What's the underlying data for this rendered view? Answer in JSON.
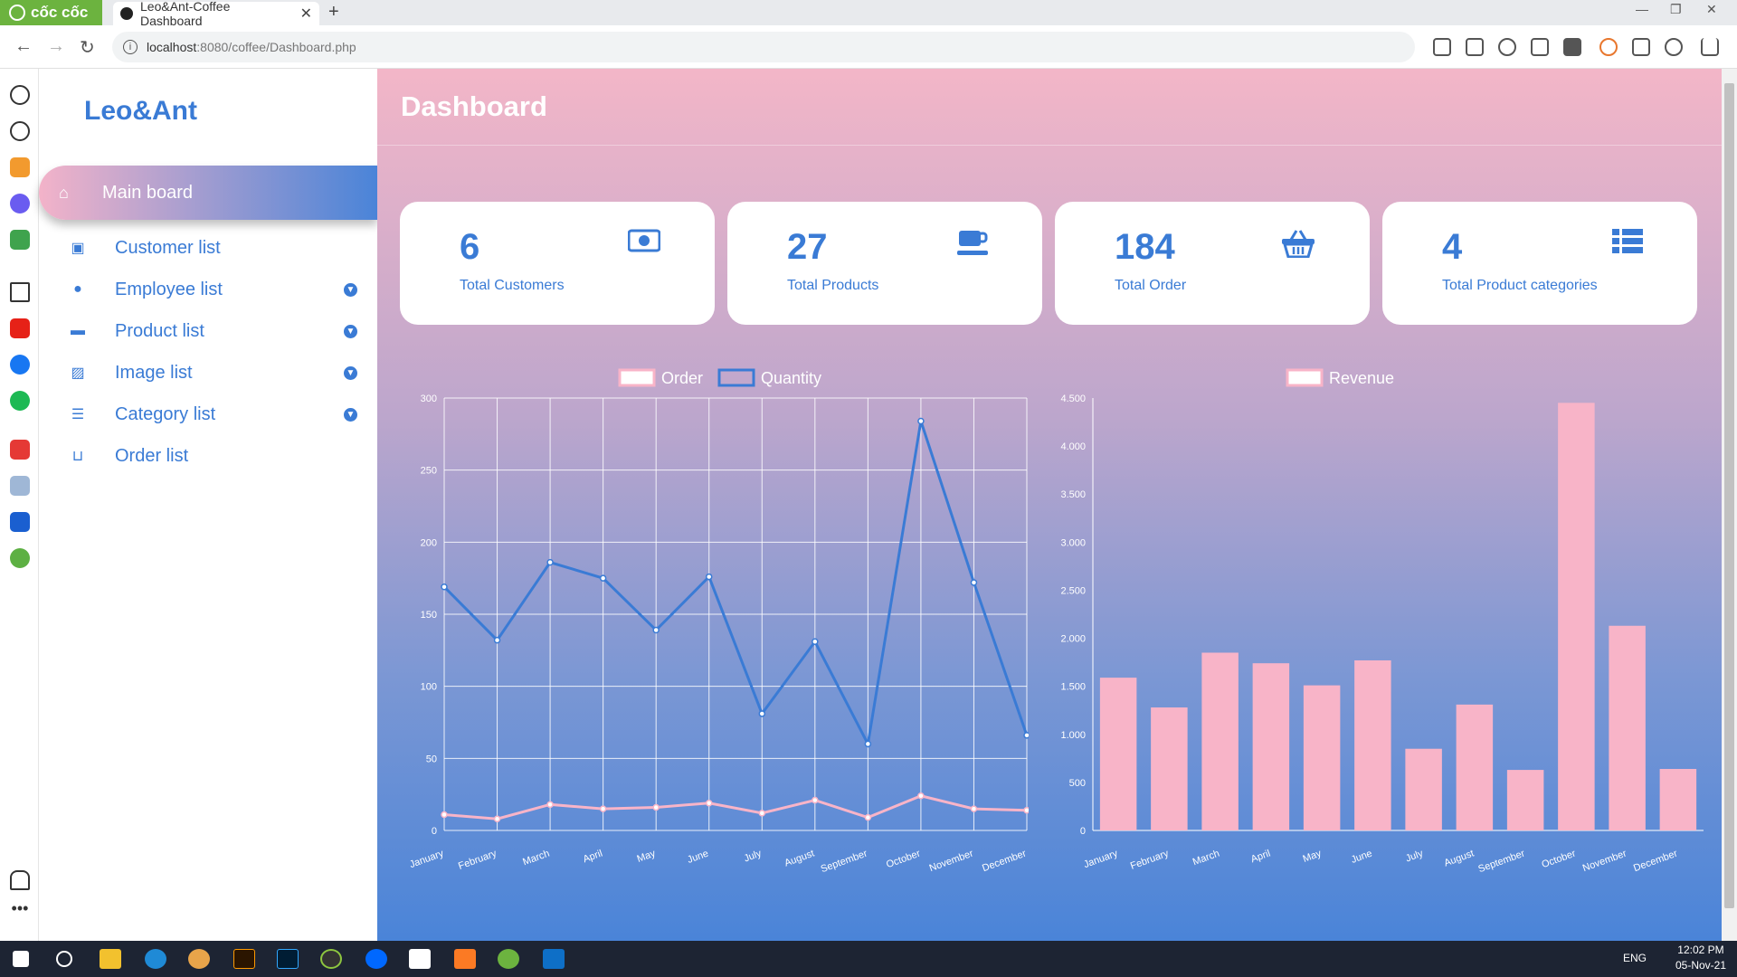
{
  "browser": {
    "brand": "cốc cốc",
    "tab_title": "Leo&Ant-Coffee Dashboard",
    "url_host": "localhost",
    "url_rest": ":8080/coffee/Dashboard.php"
  },
  "sidebar": {
    "logo": "Leo&Ant",
    "active": {
      "label": "Main board",
      "icon": "home-icon"
    },
    "items": [
      {
        "label": "Customer list",
        "icon": "money-icon",
        "dropdown": false
      },
      {
        "label": "Employee list",
        "icon": "users-icon",
        "dropdown": true
      },
      {
        "label": "Product list",
        "icon": "coffee-icon",
        "dropdown": true
      },
      {
        "label": "Image list",
        "icon": "image-icon",
        "dropdown": true
      },
      {
        "label": "Category list",
        "icon": "list-icon",
        "dropdown": true
      },
      {
        "label": "Order list",
        "icon": "basket-icon",
        "dropdown": false
      }
    ]
  },
  "page_title": "Dashboard",
  "cards": [
    {
      "value": "6",
      "label": "Total Customers",
      "icon": "money-icon"
    },
    {
      "value": "27",
      "label": "Total Products",
      "icon": "coffee-icon"
    },
    {
      "value": "184",
      "label": "Total Order",
      "icon": "basket-icon"
    },
    {
      "value": "4",
      "label": "Total Product categories",
      "icon": "list-icon"
    }
  ],
  "chart_data": [
    {
      "type": "line",
      "categories": [
        "January",
        "February",
        "March",
        "April",
        "May",
        "June",
        "July",
        "August",
        "September",
        "October",
        "November",
        "December"
      ],
      "series": [
        {
          "name": "Order",
          "color": "#f8b4c8",
          "values": [
            11,
            8,
            18,
            15,
            16,
            19,
            12,
            21,
            9,
            24,
            15,
            14
          ]
        },
        {
          "name": "Quantity",
          "color": "#3a7bd5",
          "values": [
            169,
            132,
            186,
            175,
            139,
            176,
            81,
            131,
            60,
            284,
            172,
            66
          ]
        }
      ],
      "yticks": [
        "0",
        "50",
        "100",
        "150",
        "200",
        "250",
        "300"
      ],
      "ylim": [
        0,
        300
      ],
      "grid": true,
      "legend": "top"
    },
    {
      "type": "bar",
      "categories": [
        "January",
        "February",
        "March",
        "April",
        "May",
        "June",
        "July",
        "August",
        "September",
        "October",
        "November",
        "December"
      ],
      "series": [
        {
          "name": "Revenue",
          "color": "#f8b4c8",
          "values": [
            1590,
            1280,
            1850,
            1740,
            1510,
            1770,
            850,
            1310,
            630,
            4450,
            2130,
            640
          ]
        }
      ],
      "yticks": [
        "0",
        "500",
        "1.000",
        "1.500",
        "2.000",
        "2.500",
        "3.000",
        "3.500",
        "4.000",
        "4.500"
      ],
      "ylim": [
        0,
        4500
      ],
      "grid": false,
      "legend": "top"
    }
  ],
  "taskbar": {
    "lang": "ENG",
    "time": "12:02 PM",
    "date": "05-Nov-21"
  }
}
